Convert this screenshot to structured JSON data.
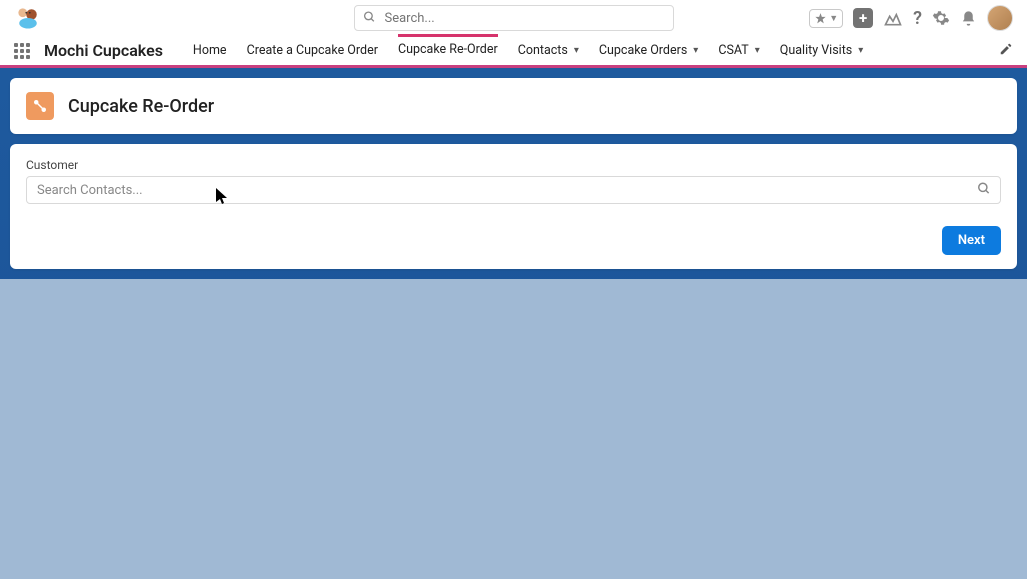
{
  "header": {
    "search_placeholder": "Search..."
  },
  "nav": {
    "app_name": "Mochi Cupcakes",
    "tabs": [
      {
        "label": "Home",
        "has_dropdown": false
      },
      {
        "label": "Create a Cupcake Order",
        "has_dropdown": false
      },
      {
        "label": "Cupcake Re-Order",
        "has_dropdown": false,
        "active": true
      },
      {
        "label": "Contacts",
        "has_dropdown": true
      },
      {
        "label": "Cupcake Orders",
        "has_dropdown": true
      },
      {
        "label": "CSAT",
        "has_dropdown": true
      },
      {
        "label": "Quality Visits",
        "has_dropdown": true
      }
    ]
  },
  "page": {
    "title": "Cupcake Re-Order",
    "customer_label": "Customer",
    "customer_placeholder": "Search Contacts...",
    "next_button": "Next"
  }
}
